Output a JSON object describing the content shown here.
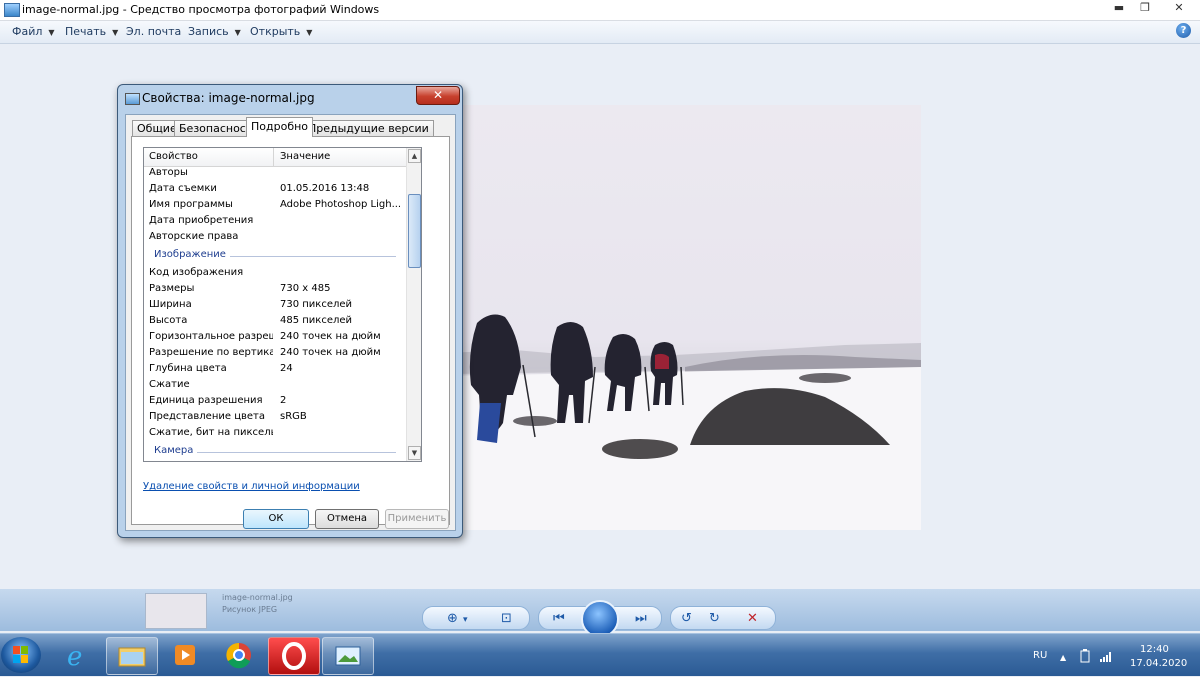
{
  "window": {
    "title": "image-normal.jpg - Средство просмотра фотографий Windows",
    "min_glyph": "▬",
    "max_glyph": "❐",
    "close_glyph": "✕"
  },
  "menu": {
    "items": [
      {
        "label": "Файл",
        "arrow": "▼"
      },
      {
        "label": "Печать",
        "arrow": "▼"
      },
      {
        "label": "Эл. почта",
        "arrow": ""
      },
      {
        "label": "Запись",
        "arrow": "▼"
      },
      {
        "label": "Открыть",
        "arrow": "▼"
      }
    ],
    "help": "?"
  },
  "dialog": {
    "title": "Свойства: image-normal.jpg",
    "close": "✕",
    "tabs": [
      "Общие",
      "Безопасность",
      "Подробно",
      "Предыдущие версии"
    ],
    "active_tab": "Подробно",
    "columns": {
      "property": "Свойство",
      "value": "Значение"
    },
    "rows_top": [
      {
        "k": "Авторы",
        "v": ""
      },
      {
        "k": "Дата съемки",
        "v": "01.05.2016 13:48"
      },
      {
        "k": "Имя программы",
        "v": "Adobe Photoshop Ligh..."
      },
      {
        "k": "Дата приобретения",
        "v": ""
      },
      {
        "k": "Авторские права",
        "v": ""
      }
    ],
    "group_image": "Изображение",
    "rows_image": [
      {
        "k": "Код изображения",
        "v": ""
      },
      {
        "k": "Размеры",
        "v": "730 x 485"
      },
      {
        "k": "Ширина",
        "v": "730 пикселей"
      },
      {
        "k": "Высота",
        "v": "485 пикселей"
      },
      {
        "k": "Горизонтальное разреше...",
        "v": "240 точек на дюйм"
      },
      {
        "k": "Разрешение по вертикали",
        "v": "240 точек на дюйм"
      },
      {
        "k": "Глубина цвета",
        "v": "24"
      },
      {
        "k": "Сжатие",
        "v": ""
      },
      {
        "k": "Единица разрешения",
        "v": "2"
      },
      {
        "k": "Представление цвета",
        "v": "sRGB"
      },
      {
        "k": "Сжатие, бит на пиксель",
        "v": ""
      }
    ],
    "group_camera": "Камера",
    "remove_link": "Удаление свойств и личной информации",
    "buttons": {
      "ok": "ОК",
      "cancel": "Отмена",
      "apply": "Применить"
    }
  },
  "strip": {
    "ghost_name": "image-normal.jpg",
    "ghost_format": "Рисунок JPEG"
  },
  "controls": {
    "zoom": "⊕",
    "zoom_arrow": "▾",
    "fit": "⊡",
    "prev": "⏮",
    "next": "⏭",
    "rotate_left": "↺",
    "rotate_right": "↻",
    "delete": "✕"
  },
  "taskbar": {
    "lang": "RU",
    "time": "12:40",
    "date": "17.04.2020",
    "tray_up": "▲"
  },
  "colors": {
    "accent": "#1e5aa8",
    "dialog_frame": "#b9d1ea",
    "taskbar": "#3f6ea6",
    "close_red": "#c7402d"
  }
}
